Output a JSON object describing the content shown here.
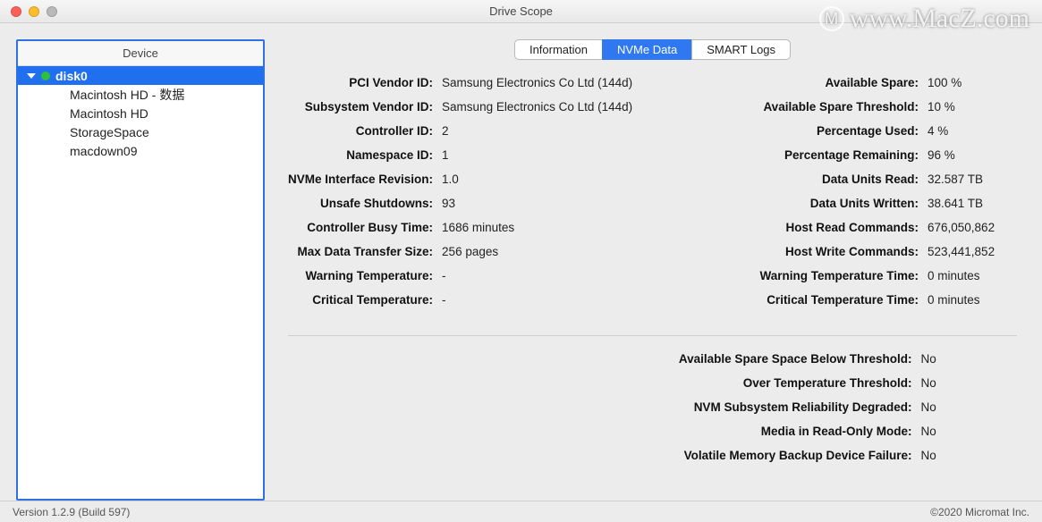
{
  "window": {
    "title": "Drive Scope"
  },
  "watermark": {
    "icon": "M",
    "text": "www.MacZ.com"
  },
  "sidebar": {
    "header": "Device",
    "items": [
      {
        "label": "disk0",
        "selected": true,
        "expandable": true,
        "status": "green"
      },
      {
        "label": "Macintosh HD - 数据",
        "child": true
      },
      {
        "label": "Macintosh HD",
        "child": true
      },
      {
        "label": "StorageSpace",
        "child": true
      },
      {
        "label": "macdown09",
        "child": true
      }
    ]
  },
  "tabs": [
    {
      "label": "Information",
      "active": false
    },
    {
      "label": "NVMe Data",
      "active": true
    },
    {
      "label": "SMART Logs",
      "active": false
    }
  ],
  "left": [
    {
      "label": "PCI Vendor ID:",
      "value": "Samsung Electronics Co Ltd (144d)"
    },
    {
      "label": "Subsystem Vendor ID:",
      "value": "Samsung Electronics Co Ltd (144d)"
    },
    {
      "label": "Controller ID:",
      "value": "2"
    },
    {
      "label": "Namespace ID:",
      "value": "1"
    },
    {
      "label": "NVMe Interface Revision:",
      "value": "1.0"
    },
    {
      "label": "Unsafe Shutdowns:",
      "value": "93"
    },
    {
      "label": "Controller Busy Time:",
      "value": "1686 minutes"
    },
    {
      "label": "Max Data Transfer Size:",
      "value": "256 pages"
    },
    {
      "label": "Warning Temperature:",
      "value": "-"
    },
    {
      "label": "Critical Temperature:",
      "value": "-"
    }
  ],
  "right": [
    {
      "label": "Available Spare:",
      "value": "100 %"
    },
    {
      "label": "Available Spare Threshold:",
      "value": "10 %"
    },
    {
      "label": "Percentage Used:",
      "value": "4 %"
    },
    {
      "label": "Percentage Remaining:",
      "value": "96 %"
    },
    {
      "label": "Data Units Read:",
      "value": "32.587 TB"
    },
    {
      "label": "Data Units Written:",
      "value": "38.641 TB"
    },
    {
      "label": "Host Read Commands:",
      "value": "676,050,862"
    },
    {
      "label": "Host Write Commands:",
      "value": "523,441,852"
    },
    {
      "label": "Warning Temperature Time:",
      "value": "0 minutes"
    },
    {
      "label": "Critical Temperature Time:",
      "value": "0 minutes"
    }
  ],
  "status": [
    {
      "label": "Available Spare Space Below Threshold:",
      "value": "No"
    },
    {
      "label": "Over Temperature Threshold:",
      "value": "No"
    },
    {
      "label": "NVM Subsystem Reliability Degraded:",
      "value": "No"
    },
    {
      "label": "Media in Read-Only Mode:",
      "value": "No"
    },
    {
      "label": "Volatile Memory Backup Device Failure:",
      "value": "No"
    }
  ],
  "footer": {
    "version": "Version 1.2.9 (Build 597)",
    "copyright": "©2020 Micromat Inc."
  }
}
